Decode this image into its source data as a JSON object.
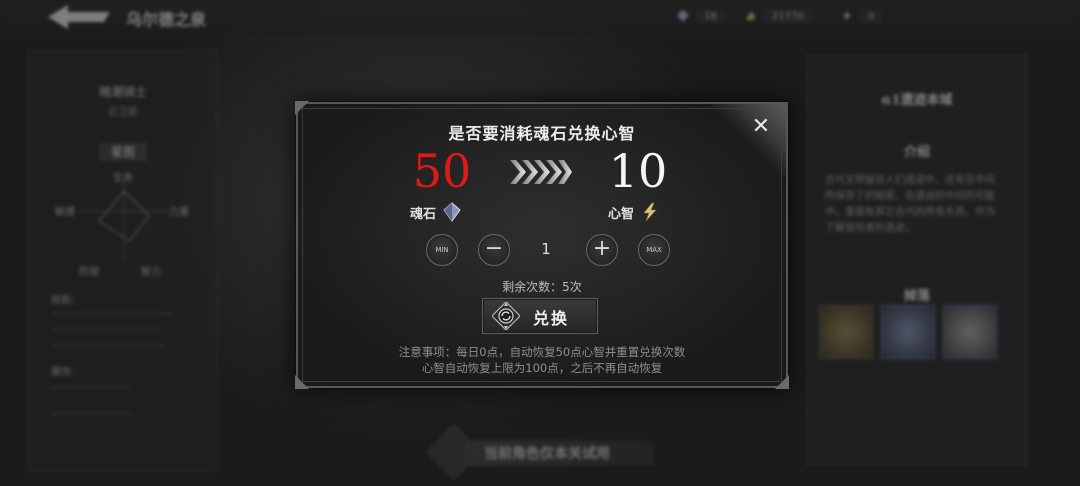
{
  "background": {
    "top_title": "乌尔德之泉",
    "resources": [
      {
        "icon": "crystal-icon",
        "value": "18"
      },
      {
        "icon": "gold-icon",
        "value": "21770"
      },
      {
        "icon": "lightning-icon",
        "value": "0"
      }
    ],
    "left_panel": {
      "name": "暗潮骑士",
      "subtitle": "近卫部",
      "tab": "星图",
      "labels": [
        "生命",
        "敏捷",
        "力量",
        "防御",
        "智力"
      ],
      "section": "技能:",
      "attr": "属性:"
    },
    "right_panel": {
      "title": "α1遗迹本域",
      "sub": "介绍",
      "body": "古代文明留在人们遗迹中，还有在中间所保存了的秘密，在遗迹的中间的可能中，里面有其它古代的所有东西，作为了解冒险者的遗迹。",
      "sub2": "掉落"
    },
    "bottom_button": "当前角色仅本关试用"
  },
  "dialog": {
    "title": "是否要消耗魂石兑换心智",
    "cost_value": "50",
    "gain_value": "10",
    "cost_currency": "魂石",
    "gain_currency": "心智",
    "min_label": "MIN",
    "max_label": "MAX",
    "minus_label": "−",
    "plus_label": "+",
    "quantity": "1",
    "remaining": "剩余次数：5次",
    "exchange_label": "兑换",
    "close_label": "✕",
    "note_line1": "注意事项：每日0点，自动恢复50点心智并重置兑换次数",
    "note_line2": "心智自动恢复上限为100点，之后不再自动恢复"
  },
  "colors": {
    "cost_red": "#e01818",
    "gain_white": "#f5f5f5"
  }
}
